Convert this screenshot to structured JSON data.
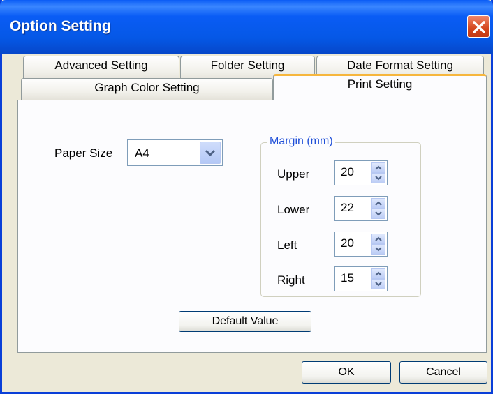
{
  "window": {
    "title": "Option Setting"
  },
  "tabs": {
    "row_back": [
      "Advanced Setting",
      "Folder Setting",
      "Date Format Setting"
    ],
    "row_front": [
      "Graph Color Setting",
      "Print Setting"
    ]
  },
  "paper": {
    "label": "Paper Size",
    "value": "A4"
  },
  "margin": {
    "title": "Margin (mm)",
    "fields": [
      {
        "label": "Upper",
        "value": "20"
      },
      {
        "label": "Lower",
        "value": "22"
      },
      {
        "label": "Left",
        "value": "20"
      },
      {
        "label": "Right",
        "value": "15"
      }
    ]
  },
  "buttons": {
    "default_value": "Default Value",
    "ok": "OK",
    "cancel": "Cancel"
  },
  "colors": {
    "title_bar": "#0558e6",
    "active_tab_accent": "#f6b63d",
    "group_title": "#1f4fd8"
  }
}
